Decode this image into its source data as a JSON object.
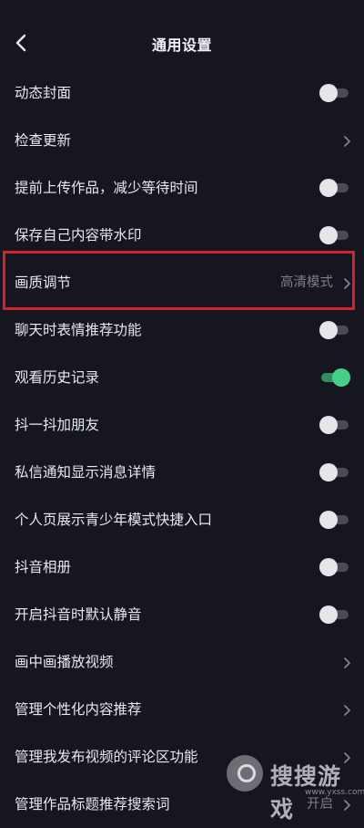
{
  "header": {
    "title": "通用设置"
  },
  "rows": [
    {
      "label": "动态封面",
      "control": "toggle",
      "on": false
    },
    {
      "label": "检查更新",
      "control": "chevron"
    },
    {
      "label": "提前上传作品，减少等待时间",
      "control": "toggle",
      "on": false
    },
    {
      "label": "保存自己内容带水印",
      "control": "toggle",
      "on": false
    },
    {
      "label": "画质调节",
      "control": "chevron",
      "value": "高清模式"
    },
    {
      "label": "聊天时表情推荐功能",
      "control": "toggle",
      "on": false
    },
    {
      "label": "观看历史记录",
      "control": "toggle",
      "on": true
    },
    {
      "label": "抖一抖加朋友",
      "control": "toggle",
      "on": false
    },
    {
      "label": "私信通知显示消息详情",
      "control": "toggle",
      "on": false
    },
    {
      "label": "个人页展示青少年模式快捷入口",
      "control": "toggle",
      "on": false
    },
    {
      "label": "抖音相册",
      "control": "toggle",
      "on": false
    },
    {
      "label": "开启抖音时默认静音",
      "control": "toggle",
      "on": false
    },
    {
      "label": "画中画播放视频",
      "control": "chevron"
    },
    {
      "label": "管理个性化内容推荐",
      "control": "chevron"
    },
    {
      "label": "管理我发布视频的评论区功能",
      "control": "chevron"
    },
    {
      "label": "管理作品标题推荐搜索词",
      "control": "chevron",
      "value": "开启"
    }
  ],
  "colors": {
    "accent_toggle_on": "#43d18a",
    "highlight_border": "#d2232a",
    "background": "#15161f"
  },
  "watermark": {
    "text": "搜搜游戏",
    "url": "www.yxss.com"
  }
}
